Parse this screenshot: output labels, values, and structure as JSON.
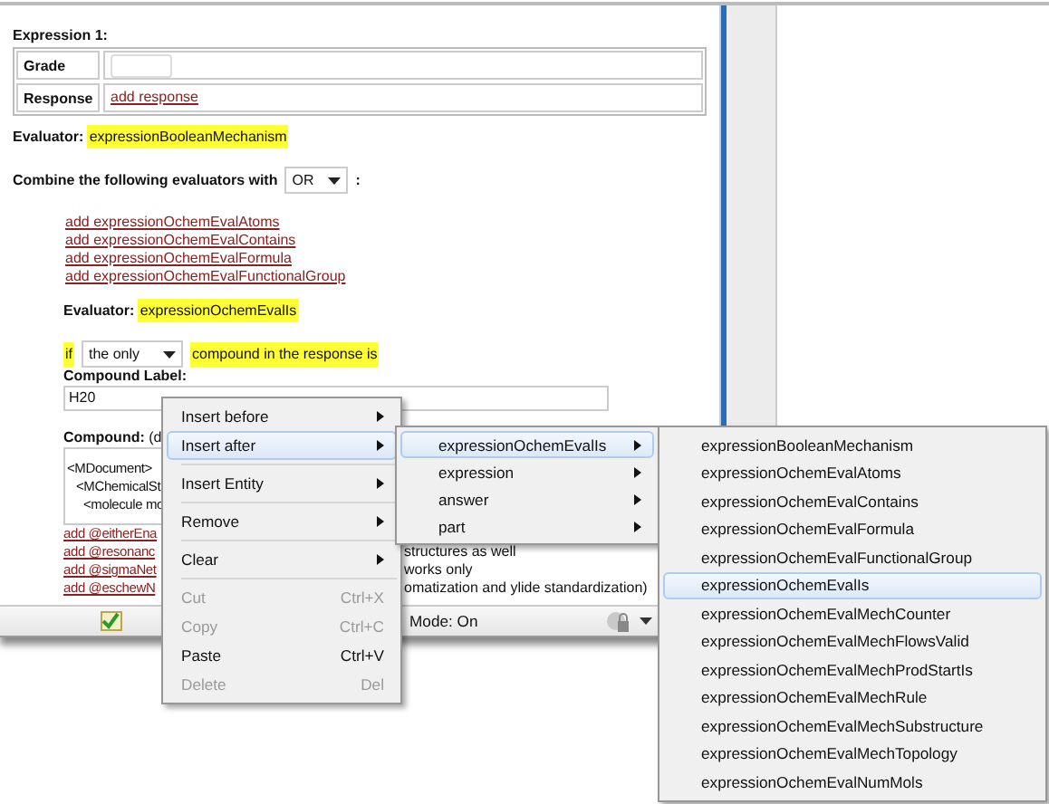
{
  "expression": {
    "title": "Expression 1:",
    "grade_label": "Grade",
    "response_label": "Response",
    "response_link": "add response"
  },
  "evaluator": {
    "label": "Evaluator:",
    "name": "expressionBooleanMechanism"
  },
  "combine": {
    "label": "Combine the following evaluators with",
    "select": "OR",
    "colon": ":"
  },
  "add_links": [
    "add expressionOchemEvalAtoms",
    "add expressionOchemEvalContains",
    "add expressionOchemEvalFormula",
    "add expressionOchemEvalFunctionalGroup"
  ],
  "inner_evaluator": {
    "label": "Evaluator:",
    "name": "expressionOchemEvalIs",
    "if": "if",
    "select": "the only",
    "suffix": "compound in the response is",
    "compound_label": "Compound Label:",
    "compound_value": "H20",
    "compound_heading": "Compound:",
    "compound_hint": "(d",
    "code_lines": [
      "<MDocument>",
      "<MChemicalSt",
      "<molecule mo"
    ],
    "option_rows": [
      {
        "link": "add @eitherEna"
      },
      {
        "link": "add @resonanc",
        "note": "structures as well"
      },
      {
        "link": "add @sigmaNet",
        "note": "works only"
      },
      {
        "link": "add @eschewN",
        "note": "omatization and ylide standardization)"
      }
    ]
  },
  "status_bar": {
    "mode": "Mode: On"
  },
  "context_menu": {
    "items": [
      {
        "kind": "item",
        "label": "Insert before",
        "has_submenu": true,
        "disabled": false,
        "selected": false
      },
      {
        "kind": "item",
        "label": "Insert after",
        "has_submenu": true,
        "disabled": false,
        "selected": true
      },
      {
        "kind": "separator"
      },
      {
        "kind": "item",
        "label": "Insert Entity",
        "has_submenu": true,
        "disabled": false,
        "selected": false
      },
      {
        "kind": "separator"
      },
      {
        "kind": "item",
        "label": "Remove",
        "has_submenu": true,
        "disabled": false,
        "selected": false
      },
      {
        "kind": "separator"
      },
      {
        "kind": "item",
        "label": "Clear",
        "has_submenu": true,
        "disabled": false,
        "selected": false
      },
      {
        "kind": "separator"
      },
      {
        "kind": "item",
        "label": "Cut",
        "shortcut": "Ctrl+X",
        "has_submenu": false,
        "disabled": true,
        "selected": false
      },
      {
        "kind": "item",
        "label": "Copy",
        "shortcut": "Ctrl+C",
        "has_submenu": false,
        "disabled": true,
        "selected": false
      },
      {
        "kind": "item",
        "label": "Paste",
        "shortcut": "Ctrl+V",
        "has_submenu": false,
        "disabled": false,
        "selected": false
      },
      {
        "kind": "item",
        "label": "Delete",
        "shortcut": "Del",
        "has_submenu": false,
        "disabled": true,
        "selected": false
      }
    ]
  },
  "insert_after_menu": {
    "items": [
      {
        "label": "expressionOchemEvalIs",
        "has_submenu": true,
        "selected": true
      },
      {
        "label": "expression",
        "has_submenu": true,
        "selected": false
      },
      {
        "label": "answer",
        "has_submenu": true,
        "selected": false
      },
      {
        "label": "part",
        "has_submenu": true,
        "selected": false
      }
    ]
  },
  "evaluator_menu": {
    "items": [
      {
        "label": "expressionBooleanMechanism",
        "selected": false
      },
      {
        "label": "expressionOchemEvalAtoms",
        "selected": false
      },
      {
        "label": "expressionOchemEvalContains",
        "selected": false
      },
      {
        "label": "expressionOchemEvalFormula",
        "selected": false
      },
      {
        "label": "expressionOchemEvalFunctionalGroup",
        "selected": false
      },
      {
        "label": "expressionOchemEvalIs",
        "selected": true
      },
      {
        "label": "expressionOchemEvalMechCounter",
        "selected": false
      },
      {
        "label": "expressionOchemEvalMechFlowsValid",
        "selected": false
      },
      {
        "label": "expressionOchemEvalMechProdStartIs",
        "selected": false
      },
      {
        "label": "expressionOchemEvalMechRule",
        "selected": false
      },
      {
        "label": "expressionOchemEvalMechSubstructure",
        "selected": false
      },
      {
        "label": "expressionOchemEvalMechTopology",
        "selected": false
      },
      {
        "label": "expressionOchemEvalNumMols",
        "selected": false
      }
    ]
  }
}
